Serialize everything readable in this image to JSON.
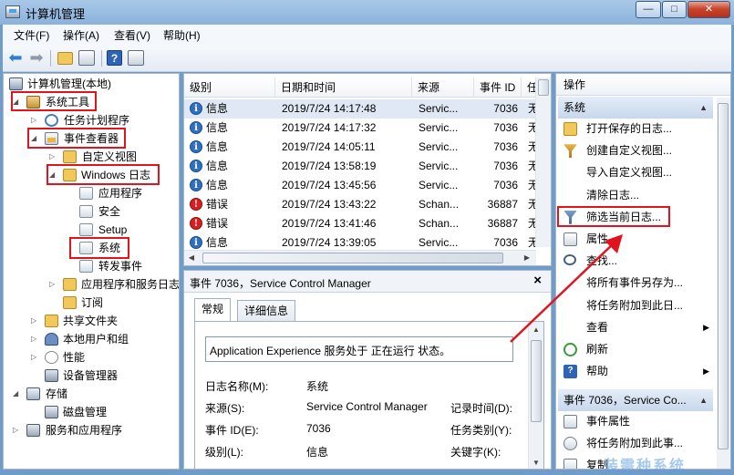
{
  "window": {
    "title": "计算机管理",
    "min_glyph": "—",
    "max_glyph": "□",
    "close_glyph": "✕"
  },
  "menu": [
    "文件(F)",
    "操作(A)",
    "查看(V)",
    "帮助(H)"
  ],
  "tree": {
    "root": "计算机管理(本地)",
    "system_tools": "系统工具",
    "task_scheduler": "任务计划程序",
    "event_viewer": "事件查看器",
    "custom_views": "自定义视图",
    "windows_logs": "Windows 日志",
    "log_application": "应用程序",
    "log_security": "安全",
    "log_setup": "Setup",
    "log_system": "系统",
    "log_forwarded": "转发事件",
    "apps_services_logs": "应用程序和服务日志",
    "subscriptions": "订阅",
    "shared_folders": "共享文件夹",
    "local_users": "本地用户和组",
    "performance": "性能",
    "device_manager": "设备管理器",
    "storage": "存储",
    "disk_management": "磁盘管理",
    "services_apps": "服务和应用程序"
  },
  "events": {
    "columns": [
      "级别",
      "日期和时间",
      "来源",
      "事件 ID",
      "任"
    ],
    "rows": [
      {
        "level": "信息",
        "type": "info",
        "datetime": "2019/7/24 14:17:48",
        "source": "Servic...",
        "id": "7036",
        "task": "无"
      },
      {
        "level": "信息",
        "type": "info",
        "datetime": "2019/7/24 14:17:32",
        "source": "Servic...",
        "id": "7036",
        "task": "无"
      },
      {
        "level": "信息",
        "type": "info",
        "datetime": "2019/7/24 14:05:11",
        "source": "Servic...",
        "id": "7036",
        "task": "无"
      },
      {
        "level": "信息",
        "type": "info",
        "datetime": "2019/7/24 13:58:19",
        "source": "Servic...",
        "id": "7036",
        "task": "无"
      },
      {
        "level": "信息",
        "type": "info",
        "datetime": "2019/7/24 13:45:56",
        "source": "Servic...",
        "id": "7036",
        "task": "无"
      },
      {
        "level": "错误",
        "type": "error",
        "datetime": "2019/7/24 13:43:22",
        "source": "Schan...",
        "id": "36887",
        "task": "无"
      },
      {
        "level": "错误",
        "type": "error",
        "datetime": "2019/7/24 13:41:46",
        "source": "Schan...",
        "id": "36887",
        "task": "无"
      },
      {
        "level": "信息",
        "type": "info",
        "datetime": "2019/7/24 13:39:05",
        "source": "Servic...",
        "id": "7036",
        "task": "无"
      }
    ]
  },
  "detail": {
    "title": "事件 7036，Service Control Manager",
    "tab_general": "常规",
    "tab_details": "详细信息",
    "description": "Application Experience 服务处于 正在运行 状态。",
    "log_name_label": "日志名称(M):",
    "log_name_value": "系统",
    "source_label": "来源(S):",
    "source_value": "Service Control Manager",
    "logged_label": "记录时间(D):",
    "event_id_label": "事件 ID(E):",
    "event_id_value": "7036",
    "task_cat_label": "任务类别(Y):",
    "level_label": "级别(L):",
    "level_value": "信息",
    "keywords_label": "关键字(K):"
  },
  "actions": {
    "title": "操作",
    "section_system": "系统",
    "items_system": [
      {
        "label": "打开保存的日志...",
        "icon": "open-log-icon"
      },
      {
        "label": "创建自定义视图...",
        "icon": "create-view-icon"
      },
      {
        "label": "导入自定义视图...",
        "icon": ""
      },
      {
        "label": "清除日志...",
        "icon": ""
      },
      {
        "label": "筛选当前日志...",
        "icon": "filter-icon"
      },
      {
        "label": "属性",
        "icon": "properties-icon"
      },
      {
        "label": "查找...",
        "icon": "find-icon"
      },
      {
        "label": "将所有事件另存为...",
        "icon": ""
      },
      {
        "label": "将任务附加到此日...",
        "icon": ""
      },
      {
        "label": "查看",
        "icon": "",
        "submenu": true
      },
      {
        "label": "刷新",
        "icon": "refresh-icon"
      },
      {
        "label": "帮助",
        "icon": "help-icon",
        "submenu": true
      }
    ],
    "section_event": "事件 7036，Service Co...",
    "items_event": [
      {
        "label": "事件属性",
        "icon": "event-properties-icon"
      },
      {
        "label": "将任务附加到此事...",
        "icon": "attach-task-icon"
      },
      {
        "label": "复制",
        "icon": "copy-icon"
      }
    ]
  },
  "watermark": "装需种系统"
}
